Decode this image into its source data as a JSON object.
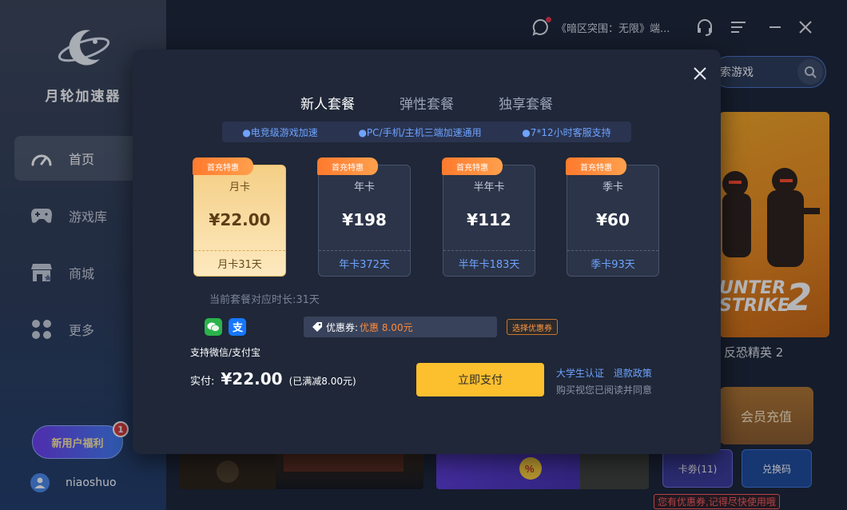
{
  "app": {
    "name": "月轮加速器"
  },
  "sidebar": {
    "items": [
      {
        "label": "首页",
        "active": true
      },
      {
        "label": "游戏库",
        "active": false
      },
      {
        "label": "商城",
        "active": false
      },
      {
        "label": "更多",
        "active": false
      }
    ],
    "new_user_label": "新用户福利",
    "new_user_badge": "1",
    "username": "niaoshuo"
  },
  "topbar": {
    "notice_text": "《暗区突围：无限》端...",
    "icons": [
      "message-icon",
      "headset-icon",
      "menu-icon",
      "minimize-icon",
      "close-icon"
    ]
  },
  "search": {
    "placeholder": "索游戏"
  },
  "game": {
    "title": "反恐精英 2",
    "cover_text_line1": "UNTER",
    "cover_text_line2": "STRIKE",
    "cover_number": "2"
  },
  "right_panel": {
    "vip_label": "会员充值",
    "coupon_button": "卡劵(11)",
    "redeem_button": "兑换码",
    "coupon_tip": "您有优惠券,记得尽快使用哦"
  },
  "modal": {
    "tabs": [
      {
        "label": "新人套餐",
        "active": true
      },
      {
        "label": "弹性套餐",
        "active": false
      },
      {
        "label": "独享套餐",
        "active": false
      }
    ],
    "features": [
      "●电竞级游戏加速",
      "●PC/手机/主机三端加速通用",
      "●7*12小时客服支持"
    ],
    "plans": [
      {
        "tag": "首充特惠",
        "name": "月卡",
        "price": "¥22.00",
        "foot": "月卡31天",
        "selected": true
      },
      {
        "tag": "首充特惠",
        "name": "年卡",
        "price": "¥198",
        "foot": "年卡372天",
        "selected": false
      },
      {
        "tag": "首充特惠",
        "name": "半年卡",
        "price": "¥112",
        "foot": "半年卡183天",
        "selected": false
      },
      {
        "tag": "首充特惠",
        "name": "季卡",
        "price": "¥60",
        "foot": "季卡93天",
        "selected": false
      }
    ],
    "duration_text": "当前套餐对应时长:31天",
    "pay_methods": [
      "wechat-pay-icon",
      "alipay-icon"
    ],
    "pay_support": "支持微信/支付宝",
    "coupon_label": "优惠券:",
    "coupon_value": "优惠 8.00元",
    "select_coupon": "选择优惠券",
    "paid_label": "实付:",
    "paid_amount": "¥22.00",
    "paid_saved": "(已满减8.00元)",
    "pay_button": "立即支付",
    "link_student": "大学生认证",
    "link_refund": "退款政策",
    "agree_text": "购买视您已阅读并同意"
  },
  "colors": {
    "accent_gold": "#fcbf2d",
    "link_blue": "#6ea3ff",
    "tag_orange": "#ff7a2d",
    "modal_bg": "#1f2738"
  }
}
